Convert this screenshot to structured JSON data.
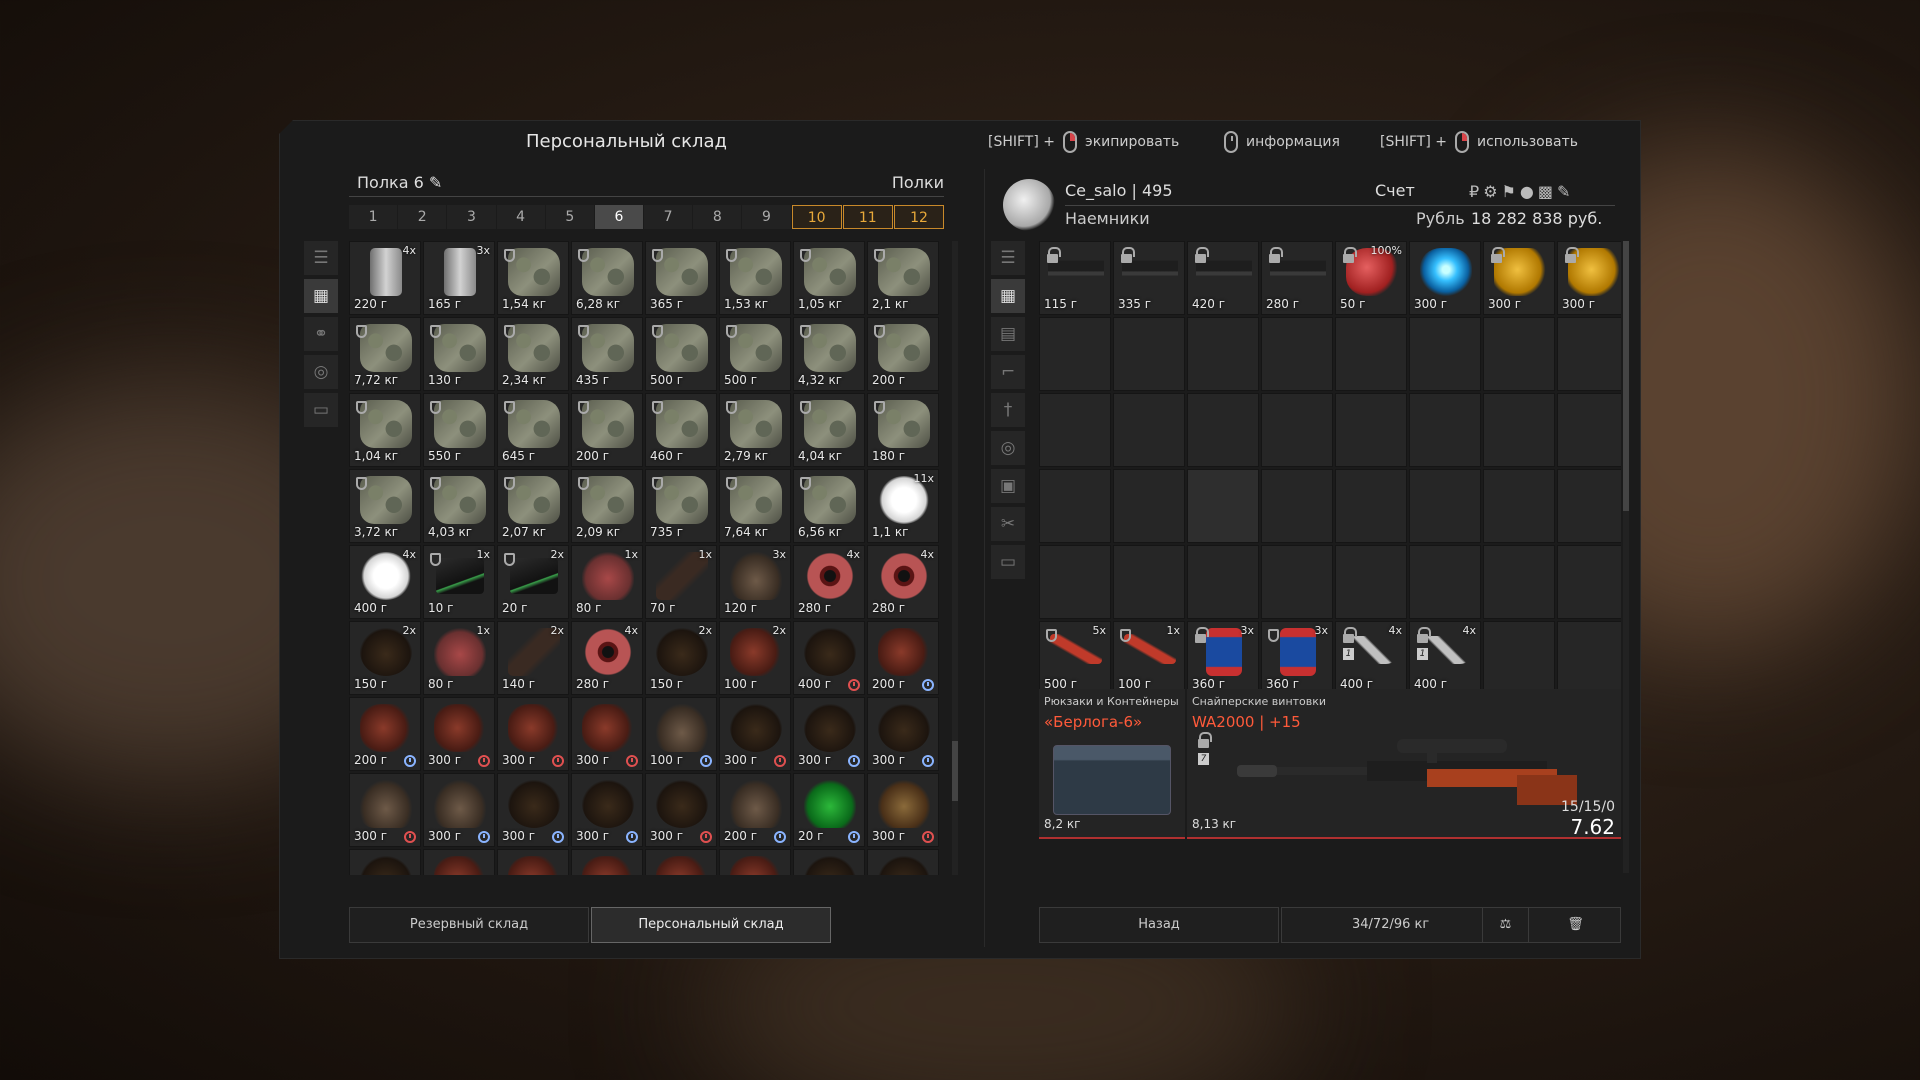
{
  "header": {
    "title": "Персональный склад",
    "hints": [
      {
        "prefix": "[SHIFT] +",
        "mouse": "right",
        "label": "экипировать"
      },
      {
        "prefix": "",
        "mouse": "none",
        "label": "информация"
      },
      {
        "prefix": "[SHIFT] +",
        "mouse": "right",
        "label": "использовать"
      }
    ]
  },
  "stash": {
    "shelf_name": "Полка 6",
    "shelves_label": "Полки",
    "pages": [
      "1",
      "2",
      "3",
      "4",
      "5",
      "6",
      "7",
      "8",
      "9",
      "10",
      "11",
      "12"
    ],
    "active_page": "6",
    "highlighted_pages": [
      "10",
      "11",
      "12"
    ],
    "sidebar_icons": [
      "sort-icon",
      "grid-icon",
      "link-icon",
      "ammo-icon",
      "container-icon"
    ],
    "items": [
      {
        "t": "can",
        "p": "220 г",
        "c": "4x"
      },
      {
        "t": "can",
        "p": "165 г",
        "c": "3x"
      },
      {
        "t": "camo",
        "p": "1,54 кг",
        "s": 1
      },
      {
        "t": "camo",
        "p": "6,28 кг",
        "s": 1
      },
      {
        "t": "camo",
        "p": "365 г",
        "s": 1
      },
      {
        "t": "camo",
        "p": "1,53 кг",
        "s": 1
      },
      {
        "t": "camo",
        "p": "1,05 кг",
        "s": 1
      },
      {
        "t": "camo",
        "p": "2,1 кг",
        "s": 1
      },
      {
        "t": "camo",
        "p": "7,72 кг",
        "s": 1
      },
      {
        "t": "camo",
        "p": "130 г",
        "s": 1
      },
      {
        "t": "camo",
        "p": "2,34 кг",
        "s": 1
      },
      {
        "t": "camo",
        "p": "435 г",
        "s": 1
      },
      {
        "t": "camo",
        "p": "500 г",
        "s": 1
      },
      {
        "t": "camo",
        "p": "500 г",
        "s": 1
      },
      {
        "t": "camo",
        "p": "4,32 кг",
        "s": 1
      },
      {
        "t": "camo",
        "p": "200 г",
        "s": 1
      },
      {
        "t": "camo",
        "p": "1,04 кг",
        "s": 1
      },
      {
        "t": "camo",
        "p": "550 г",
        "s": 1
      },
      {
        "t": "camo",
        "p": "645 г",
        "s": 1
      },
      {
        "t": "camo",
        "p": "200 г",
        "s": 1
      },
      {
        "t": "camo",
        "p": "460 г",
        "s": 1
      },
      {
        "t": "camo",
        "p": "2,79 кг",
        "s": 1
      },
      {
        "t": "camo",
        "p": "4,04 кг",
        "s": 1
      },
      {
        "t": "camo",
        "p": "180 г",
        "s": 1
      },
      {
        "t": "camo",
        "p": "3,72 кг",
        "s": 1
      },
      {
        "t": "camo",
        "p": "4,03 кг",
        "s": 1
      },
      {
        "t": "camo",
        "p": "2,07 кг",
        "s": 1
      },
      {
        "t": "camo",
        "p": "2,09 кг",
        "s": 1
      },
      {
        "t": "camo",
        "p": "735 г",
        "s": 1
      },
      {
        "t": "camo",
        "p": "7,64 кг",
        "s": 1
      },
      {
        "t": "camo",
        "p": "6,56 кг",
        "s": 1
      },
      {
        "t": "fluff",
        "p": "1,1 кг",
        "c": "11x"
      },
      {
        "t": "fluff",
        "p": "400 г",
        "c": "4x"
      },
      {
        "t": "box",
        "p": "10 г",
        "c": "1x",
        "s": 1
      },
      {
        "t": "box",
        "p": "20 г",
        "c": "2x",
        "s": 1
      },
      {
        "t": "hand",
        "p": "80 г",
        "c": "1x"
      },
      {
        "t": "feather",
        "p": "70 г",
        "c": "1x"
      },
      {
        "t": "claw",
        "p": "120 г",
        "c": "3x"
      },
      {
        "t": "eye",
        "p": "280 г",
        "c": "4x"
      },
      {
        "t": "eye",
        "p": "280 г",
        "c": "4x"
      },
      {
        "t": "dark",
        "p": "150 г",
        "c": "2x"
      },
      {
        "t": "hand",
        "p": "80 г",
        "c": "1x"
      },
      {
        "t": "feather",
        "p": "140 г",
        "c": "2x"
      },
      {
        "t": "eye",
        "p": "280 г",
        "c": "4x"
      },
      {
        "t": "dark",
        "p": "150 г",
        "c": "2x"
      },
      {
        "t": "flesh",
        "p": "100 г",
        "c": "2x"
      },
      {
        "t": "dark",
        "p": "400 г",
        "k": "r"
      },
      {
        "t": "flesh",
        "p": "200 г",
        "k": "b"
      },
      {
        "t": "flesh",
        "p": "200 г",
        "k": "b"
      },
      {
        "t": "flesh",
        "p": "300 г",
        "k": "r"
      },
      {
        "t": "flesh",
        "p": "300 г",
        "k": "r"
      },
      {
        "t": "flesh",
        "p": "300 г",
        "k": "r"
      },
      {
        "t": "claw",
        "p": "100 г",
        "k": "b"
      },
      {
        "t": "dark",
        "p": "300 г",
        "k": "r"
      },
      {
        "t": "dark",
        "p": "300 г",
        "k": "b"
      },
      {
        "t": "dark",
        "p": "300 г",
        "k": "b"
      },
      {
        "t": "claw",
        "p": "300 г",
        "k": "r"
      },
      {
        "t": "claw",
        "p": "300 г",
        "k": "b"
      },
      {
        "t": "dark",
        "p": "300 г",
        "k": "b"
      },
      {
        "t": "dark",
        "p": "300 г",
        "k": "b"
      },
      {
        "t": "dark",
        "p": "300 г",
        "k": "r"
      },
      {
        "t": "claw",
        "p": "200 г",
        "k": "b"
      },
      {
        "t": "green",
        "p": "20 г",
        "k": "b"
      },
      {
        "t": "glove",
        "p": "300 г",
        "k": "r"
      },
      {
        "t": "dark",
        "p": ""
      },
      {
        "t": "flesh",
        "p": ""
      },
      {
        "t": "flesh",
        "p": ""
      },
      {
        "t": "flesh",
        "p": ""
      },
      {
        "t": "flesh",
        "p": ""
      },
      {
        "t": "flesh",
        "p": ""
      },
      {
        "t": "dark",
        "p": ""
      },
      {
        "t": "dark",
        "p": ""
      }
    ]
  },
  "buttons": {
    "reserve": "Резервный склад",
    "personal": "Персональный склад",
    "back": "Назад"
  },
  "player": {
    "name": "Ce_salo | 495",
    "faction": "Наемники",
    "account_label": "Счет",
    "currency_label": "Рубль",
    "balance": "18 282 838 руб.",
    "currency_icons": [
      "ruble-icon",
      "gear-currency-icon",
      "boot-currency-icon",
      "coin-currency-icon",
      "token-currency-icon",
      "ticket-currency-icon"
    ]
  },
  "inventory": {
    "sidebar_icons": [
      "sort-icon",
      "grid-icon",
      "armor-icon",
      "rifle-icon",
      "knife-icon",
      "ammo-icon",
      "camera-icon",
      "tools-icon",
      "container-icon"
    ],
    "items": [
      {
        "t": "gun",
        "p": "115 г",
        "l": 1
      },
      {
        "t": "gun",
        "p": "335 г",
        "l": 1
      },
      {
        "t": "gun",
        "p": "420 г",
        "l": 1
      },
      {
        "t": "gun",
        "p": "280 г",
        "l": 1
      },
      {
        "t": "coral",
        "p": "50 г",
        "l": 1,
        "c": "100%"
      },
      {
        "t": "crystal",
        "p": "300 г"
      },
      {
        "t": "gold",
        "p": "300 г",
        "l": 1
      },
      {
        "t": "gold",
        "p": "300 г",
        "l": 1
      }
    ],
    "quick": [
      {
        "t": "torch",
        "p": "500 г",
        "c": "5x",
        "s": 1
      },
      {
        "t": "torch",
        "p": "100 г",
        "c": "1x",
        "s": 1
      },
      {
        "t": "jar",
        "p": "360 г",
        "c": "3x",
        "l": 1
      },
      {
        "t": "jar",
        "p": "360 г",
        "c": "3x",
        "s": 1
      },
      {
        "t": "inj",
        "p": "400 г",
        "c": "4x",
        "l": 1,
        "v": "1"
      },
      {
        "t": "inj",
        "p": "400 г",
        "c": "4x",
        "l": 1,
        "v": "1"
      }
    ],
    "weight": "34/72/96 кг"
  },
  "details": {
    "backpack": {
      "category": "Рюкзаки и Контейнеры",
      "name": "«Берлога-6»",
      "weight": "8,2 кг"
    },
    "weapon": {
      "category": "Снайперские винтовки",
      "name": "WA2000 | +15",
      "weight": "8,13 кг",
      "level": "7",
      "ammo": "15/15/0",
      "caliber": "7.62"
    }
  }
}
